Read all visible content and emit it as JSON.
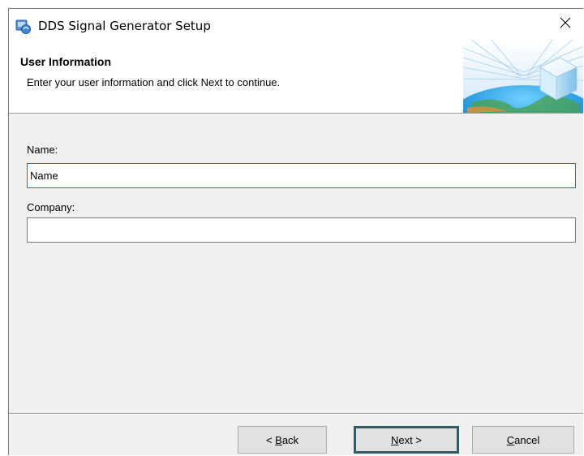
{
  "window": {
    "title": "DDS Signal Generator Setup",
    "icon": "installer-icon",
    "close_glyph": "✕"
  },
  "banner": {
    "title": "User Information",
    "subtitle": "Enter your user information and click Next to continue.",
    "image": "setup-cube-globe-art"
  },
  "form": {
    "name_label": "Name:",
    "name_value": "Name",
    "company_label": "Company:",
    "company_value": ""
  },
  "buttons": {
    "back": {
      "prefix": "< ",
      "mnemonic": "B",
      "rest": "ack"
    },
    "next": {
      "mnemonic": "N",
      "rest": "ext >"
    },
    "cancel": {
      "mnemonic": "C",
      "rest": "ancel"
    }
  },
  "colors": {
    "focus_border": "#0078d7",
    "default_button_border": "#2e5d68",
    "dialog_background": "#f0f0f0"
  }
}
